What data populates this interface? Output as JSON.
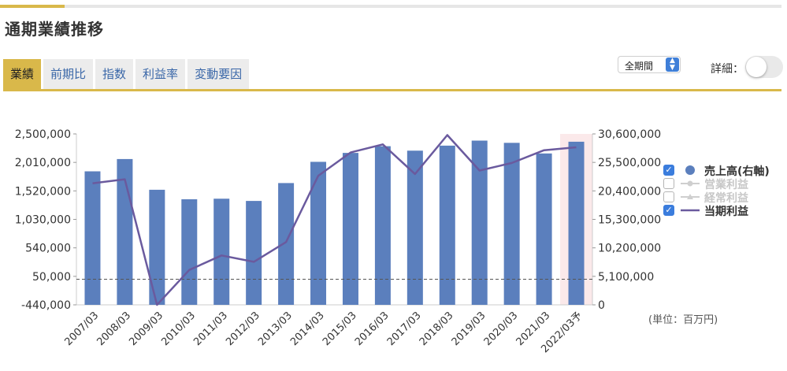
{
  "page": {
    "title": "通期業績推移"
  },
  "tabs": [
    {
      "label": "業績",
      "active": true
    },
    {
      "label": "前期比",
      "active": false
    },
    {
      "label": "指数",
      "active": false
    },
    {
      "label": "利益率",
      "active": false
    },
    {
      "label": "変動要因",
      "active": false
    }
  ],
  "controls": {
    "period_select": {
      "value": "全期間",
      "icon": "up-down-stepper-icon"
    },
    "detail_label": "詳細：",
    "detail_toggle_on": false
  },
  "legend": {
    "items": [
      {
        "label": "売上高(右軸)",
        "checked": true,
        "marker": "circle",
        "active": true
      },
      {
        "label": "営業利益",
        "checked": false,
        "marker": "line-circle",
        "active": false
      },
      {
        "label": "経常利益",
        "checked": false,
        "marker": "line-triangle",
        "active": false
      },
      {
        "label": "当期利益",
        "checked": true,
        "marker": "line",
        "active": true
      }
    ]
  },
  "unit_note": "(単位：百万円)",
  "colors": {
    "accent": "#d9b84a",
    "bar": "#5b7fbd",
    "line": "#6a5a9e",
    "tab_text": "#3a67a8",
    "forecast_band": "#fbe9ea"
  },
  "chart_data": {
    "type": "bar",
    "categories": [
      "2007/03",
      "2008/03",
      "2009/03",
      "2010/03",
      "2011/03",
      "2012/03",
      "2013/03",
      "2014/03",
      "2015/03",
      "2016/03",
      "2017/03",
      "2018/03",
      "2019/03",
      "2020/03",
      "2021/03",
      "2022/03予"
    ],
    "forecast_index": 15,
    "left_axis": {
      "ylim": [
        -440000,
        2500000
      ],
      "ticks": [
        "2,500,000",
        "2,010,000",
        "1,520,000",
        "1,030,000",
        "540,000",
        "50,000",
        "-440,000"
      ],
      "tick_values": [
        2500000,
        2010000,
        1520000,
        1030000,
        540000,
        50000,
        -440000
      ]
    },
    "right_axis": {
      "ylim": [
        0,
        30600000
      ],
      "ticks": [
        "30,600,000",
        "25,500,000",
        "20,400,000",
        "15,300,000",
        "10,200,000",
        "5,100,000",
        "0"
      ],
      "tick_values": [
        30600000,
        25500000,
        20400000,
        15300000,
        10200000,
        5100000,
        0
      ]
    },
    "reference_line": {
      "axis": "left",
      "value": 0,
      "style": "dashed"
    },
    "series": [
      {
        "name": "売上高(右軸)",
        "type": "bar",
        "axis": "right",
        "values": [
          23900000,
          26100000,
          20600000,
          18900000,
          19000000,
          18600000,
          21800000,
          25600000,
          27200000,
          28400000,
          27600000,
          28500000,
          29400000,
          29000000,
          27100000,
          29200000
        ]
      },
      {
        "name": "当期利益",
        "type": "line",
        "axis": "left",
        "values": [
          1650000,
          1720000,
          -440000,
          160000,
          410000,
          300000,
          640000,
          1780000,
          2180000,
          2320000,
          1810000,
          2480000,
          1870000,
          2000000,
          2220000,
          2270000
        ]
      }
    ]
  }
}
